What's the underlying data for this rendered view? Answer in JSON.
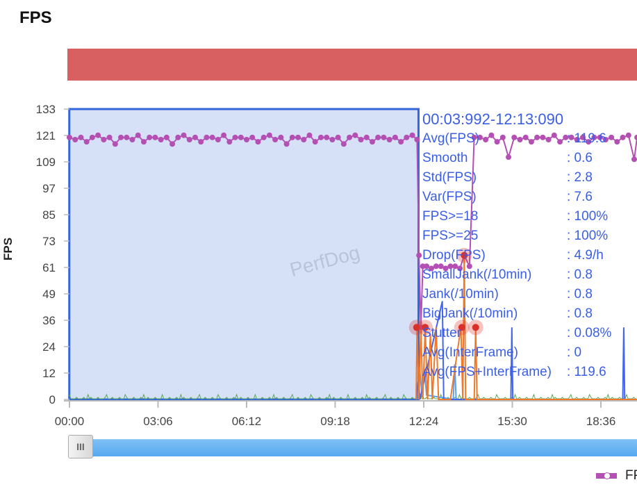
{
  "header": {
    "title": "FPS"
  },
  "colors": {
    "fps": "#b44fb4",
    "jank": "#f07828",
    "blue": "#4466ee",
    "lightblue": "#5aa0f0",
    "green": "#55aa55",
    "selection_fill": "#d6e0f7",
    "selection_border": "#3366dd",
    "bar": "#d96060",
    "stats_text": "#3a5ee8"
  },
  "watermark": "PerfDog",
  "stats": {
    "range": "00:03:992-12:13:090",
    "rows": [
      {
        "k": "Avg(FPS)",
        "v": ": 119.6"
      },
      {
        "k": "Smooth",
        "v": ": 0.6"
      },
      {
        "k": "Std(FPS)",
        "v": ": 2.8"
      },
      {
        "k": "Var(FPS)",
        "v": ": 7.6"
      },
      {
        "k": "FPS>=18",
        "v": ": 100%"
      },
      {
        "k": "FPS>=25",
        "v": ": 100%"
      },
      {
        "k": "Drop(FPS)",
        "v": ": 4.9/h"
      },
      {
        "k": "SmallJank(/10min)",
        "v": ": 0.8"
      },
      {
        "k": "Jank(/10min)",
        "v": ": 0.8"
      },
      {
        "k": "BigJank(/10min)",
        "v": ": 0.8"
      },
      {
        "k": "Stutter",
        "v": ": 0.08%"
      },
      {
        "k": "Avg(InterFrame)",
        "v": ": 0"
      },
      {
        "k": "Avg(FPS+InterFrame)",
        "v": ": 119.6"
      }
    ]
  },
  "slider": {
    "handle_glyph": "III"
  },
  "chart_data": {
    "type": "line",
    "ylabel": "FPS",
    "ylim": [
      0,
      133
    ],
    "yticks": [
      "0",
      "12",
      "24",
      "36",
      "49",
      "61",
      "73",
      "85",
      "97",
      "109",
      "121",
      "133"
    ],
    "xticks": [
      "00:00",
      "03:06",
      "06:12",
      "09:18",
      "12:24",
      "15:30",
      "18:36"
    ],
    "xtick_seconds": [
      0,
      186,
      372,
      558,
      744,
      930,
      1116
    ],
    "xlim_seconds": [
      0,
      1192
    ],
    "selection_seconds": [
      4,
      733
    ],
    "legend": [
      {
        "name": "FPS",
        "position": "bottom-right"
      }
    ],
    "series": [
      {
        "name": "FPS",
        "color": "#b44fb4",
        "points": [
          [
            0,
            120
          ],
          [
            12,
            119
          ],
          [
            24,
            120
          ],
          [
            36,
            118
          ],
          [
            48,
            120
          ],
          [
            60,
            121
          ],
          [
            72,
            119
          ],
          [
            84,
            120
          ],
          [
            96,
            117
          ],
          [
            108,
            120
          ],
          [
            120,
            120
          ],
          [
            132,
            119
          ],
          [
            144,
            121
          ],
          [
            156,
            118
          ],
          [
            168,
            120
          ],
          [
            180,
            120
          ],
          [
            192,
            119
          ],
          [
            204,
            120
          ],
          [
            216,
            117
          ],
          [
            228,
            120
          ],
          [
            240,
            121
          ],
          [
            252,
            119
          ],
          [
            264,
            120
          ],
          [
            276,
            118
          ],
          [
            288,
            120
          ],
          [
            300,
            120
          ],
          [
            312,
            119
          ],
          [
            324,
            121
          ],
          [
            336,
            118
          ],
          [
            348,
            120
          ],
          [
            360,
            120
          ],
          [
            372,
            119
          ],
          [
            384,
            120
          ],
          [
            396,
            118
          ],
          [
            408,
            120
          ],
          [
            420,
            121
          ],
          [
            432,
            119
          ],
          [
            444,
            120
          ],
          [
            456,
            117
          ],
          [
            468,
            120
          ],
          [
            480,
            120
          ],
          [
            492,
            119
          ],
          [
            504,
            121
          ],
          [
            516,
            118
          ],
          [
            528,
            120
          ],
          [
            540,
            120
          ],
          [
            552,
            119
          ],
          [
            564,
            120
          ],
          [
            576,
            117
          ],
          [
            588,
            120
          ],
          [
            600,
            121
          ],
          [
            612,
            119
          ],
          [
            624,
            120
          ],
          [
            636,
            118
          ],
          [
            648,
            120
          ],
          [
            660,
            120
          ],
          [
            672,
            119
          ],
          [
            684,
            120
          ],
          [
            696,
            118
          ],
          [
            708,
            120
          ],
          [
            720,
            121
          ],
          [
            730,
            119
          ],
          [
            734,
            66
          ],
          [
            738,
            33
          ],
          [
            742,
            61
          ],
          [
            750,
            61
          ],
          [
            760,
            60
          ],
          [
            770,
            61
          ],
          [
            780,
            61
          ],
          [
            790,
            60
          ],
          [
            800,
            61
          ],
          [
            810,
            61
          ],
          [
            820,
            60
          ],
          [
            829,
            66
          ],
          [
            840,
            61
          ],
          [
            850,
            120
          ],
          [
            862,
            120
          ],
          [
            874,
            119
          ],
          [
            886,
            121
          ],
          [
            898,
            118
          ],
          [
            910,
            120
          ],
          [
            922,
            111
          ],
          [
            934,
            120
          ],
          [
            946,
            119
          ],
          [
            958,
            120
          ],
          [
            970,
            118
          ],
          [
            982,
            120
          ],
          [
            994,
            120
          ],
          [
            1006,
            119
          ],
          [
            1018,
            121
          ],
          [
            1030,
            118
          ],
          [
            1042,
            120
          ],
          [
            1054,
            120
          ],
          [
            1066,
            119
          ],
          [
            1078,
            120
          ],
          [
            1090,
            118
          ],
          [
            1102,
            120
          ],
          [
            1114,
            120
          ],
          [
            1126,
            119
          ],
          [
            1138,
            120
          ],
          [
            1150,
            118
          ],
          [
            1162,
            120
          ],
          [
            1174,
            121
          ],
          [
            1186,
            110
          ],
          [
            1192,
            120
          ]
        ]
      },
      {
        "name": "",
        "color": "#f07828",
        "points": [
          [
            728,
            0
          ],
          [
            730,
            33
          ],
          [
            734,
            0
          ],
          [
            738,
            33
          ],
          [
            742,
            0
          ],
          [
            747,
            33
          ],
          [
            752,
            0
          ],
          [
            758,
            30
          ],
          [
            762,
            0
          ],
          [
            770,
            33
          ],
          [
            775,
            0
          ],
          [
            800,
            0
          ],
          [
            822,
            33
          ],
          [
            826,
            0
          ],
          [
            829,
            66
          ],
          [
            832,
            0
          ],
          [
            850,
            0
          ],
          [
            853,
            33
          ],
          [
            856,
            0
          ],
          [
            1192,
            0
          ]
        ]
      },
      {
        "name": "",
        "color": "#4466ee",
        "points": [
          [
            728,
            0
          ],
          [
            733,
            10
          ],
          [
            736,
            0
          ],
          [
            783,
            45
          ],
          [
            786,
            0
          ],
          [
            927,
            0
          ],
          [
            929,
            33
          ],
          [
            931,
            0
          ],
          [
            1162,
            0
          ],
          [
            1164,
            33
          ],
          [
            1166,
            0
          ],
          [
            1192,
            0
          ]
        ]
      },
      {
        "name": "",
        "color": "#5aa0f0",
        "points": [
          [
            730,
            0
          ],
          [
            735,
            15
          ],
          [
            740,
            3
          ],
          [
            745,
            14
          ],
          [
            750,
            2
          ],
          [
            806,
            0
          ],
          [
            809,
            16
          ],
          [
            812,
            0
          ],
          [
            1192,
            0
          ]
        ]
      }
    ],
    "jank_markers": [
      [
        729,
        33
      ],
      [
        747,
        33
      ],
      [
        824,
        33
      ],
      [
        829,
        66
      ],
      [
        853,
        33
      ]
    ]
  }
}
